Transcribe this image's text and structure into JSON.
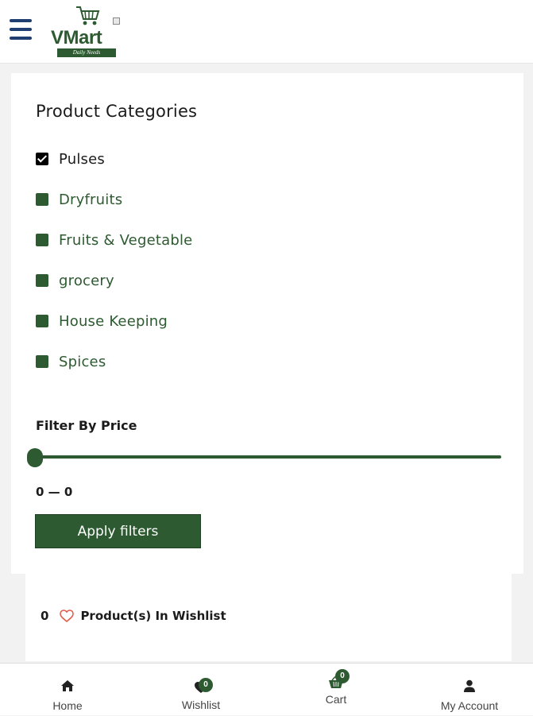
{
  "header": {
    "logo_text": "VMart",
    "logo_tagline": "Daily Needs",
    "menu_icon": "hamburger-menu-icon"
  },
  "filters": {
    "categories_title": "Product Categories",
    "categories": [
      {
        "label": "Pulses",
        "checked": true
      },
      {
        "label": "Dryfruits",
        "checked": false
      },
      {
        "label": "Fruits & Vegetable",
        "checked": false
      },
      {
        "label": "grocery",
        "checked": false
      },
      {
        "label": "House Keeping",
        "checked": false
      },
      {
        "label": "Spices",
        "checked": false
      }
    ],
    "price_title": "Filter By Price",
    "price_range": "0 — 0",
    "price_min": 0,
    "price_max": 0,
    "apply_label": "Apply filters"
  },
  "wishlist": {
    "count": "0",
    "label": "Product(s) In Wishlist"
  },
  "bottom_nav": {
    "items": [
      {
        "label": "Home",
        "icon": "home-icon"
      },
      {
        "label": "Wishlist",
        "icon": "heart-icon",
        "badge": "0"
      },
      {
        "label": "Cart",
        "icon": "basket-icon",
        "badge": "0"
      },
      {
        "label": "My Account",
        "icon": "user-icon"
      }
    ]
  },
  "colors": {
    "brand_green": "#2d5a30",
    "menu_blue": "#1f3f72",
    "wishlist_heart": "#e25c4a"
  }
}
